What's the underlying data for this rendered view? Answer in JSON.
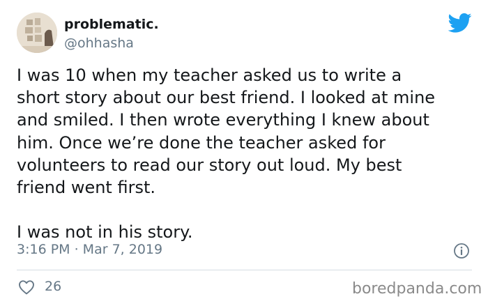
{
  "author": {
    "display_name": "problematic.",
    "handle": "@ohhasha",
    "avatar_icon": "profile-photo"
  },
  "brand": {
    "logo_icon": "twitter-bird-icon",
    "color": "#1da1f2"
  },
  "tweet": {
    "text": "I was 10 when my teacher asked us to write a\nshort story about our best friend. I looked at mine\nand smiled. I then wrote everything I knew about\nhim. Once we’re done the teacher asked for\nvolunteers to read our story out loud. My best\nfriend went first.\n\nI was not in his story.",
    "timestamp": "3:16 PM · Mar 7, 2019"
  },
  "engagement": {
    "likes": "26",
    "like_icon": "heart-outline-icon"
  },
  "info_icon": "info-circle-icon",
  "watermark": "boredpanda.com",
  "colors": {
    "text": "#14171a",
    "muted": "#657786",
    "divider": "#d5dde3"
  }
}
